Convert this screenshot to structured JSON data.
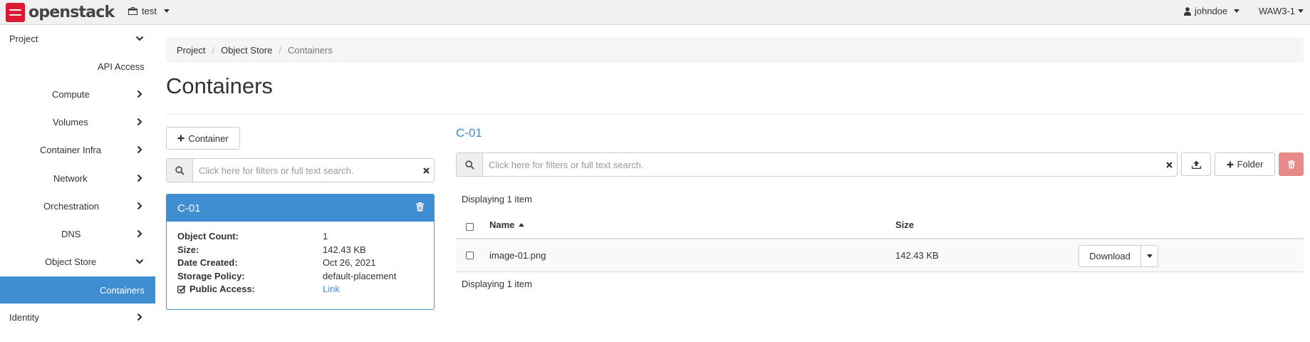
{
  "navbar": {
    "brand": "openstack",
    "project": "test",
    "user": "johndoe",
    "region": "WAW3-1"
  },
  "sidebar": {
    "items": [
      {
        "label": "Project"
      },
      {
        "label": "API Access"
      },
      {
        "label": "Compute"
      },
      {
        "label": "Volumes"
      },
      {
        "label": "Container Infra"
      },
      {
        "label": "Network"
      },
      {
        "label": "Orchestration"
      },
      {
        "label": "DNS"
      },
      {
        "label": "Object Store"
      },
      {
        "label": "Containers"
      },
      {
        "label": "Identity"
      }
    ]
  },
  "breadcrumb": [
    "Project",
    "Object Store",
    "Containers"
  ],
  "page_title": "Containers",
  "containers_panel": {
    "add_button": "Container",
    "search_placeholder": "Click here for filters or full text search.",
    "card": {
      "name": "C-01",
      "fields": [
        {
          "key": "Object Count:",
          "value": "1"
        },
        {
          "key": "Size:",
          "value": "142.43 KB"
        },
        {
          "key": "Date Created:",
          "value": "Oct 26, 2021"
        },
        {
          "key": "Storage Policy:",
          "value": "default-placement"
        },
        {
          "key": "Public Access:",
          "value": "Link"
        }
      ]
    }
  },
  "objects_panel": {
    "container_name": "C-01",
    "search_placeholder": "Click here for filters or full text search.",
    "folder_button": "Folder",
    "displaying_top": "Displaying 1 item",
    "displaying_bottom": "Displaying 1 item",
    "columns": [
      "Name",
      "Size"
    ],
    "rows": [
      {
        "name": "image-01.png",
        "size": "142.43 KB",
        "action": "Download"
      }
    ]
  },
  "colors": {
    "accent": "#3f8ed2",
    "danger": "#e8898a",
    "brand_red": "#da1a32"
  },
  "icons": [
    "briefcase-icon",
    "user-icon",
    "chevron-down-icon",
    "chevron-right-icon",
    "plus-icon",
    "search-icon",
    "close-icon",
    "trash-icon",
    "check-square-icon",
    "upload-icon",
    "sort-asc-icon"
  ]
}
